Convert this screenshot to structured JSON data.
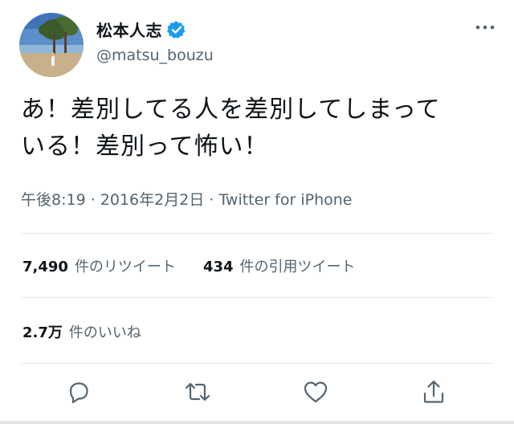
{
  "user": {
    "display_name": "松本人志",
    "handle": "@matsu_bouzu",
    "verified": true
  },
  "tweet": {
    "text_line1": "あ！差別してる人を差別してしまって",
    "text_line2": "いる！差別って怖い！"
  },
  "meta": {
    "time": "午後8:19",
    "separator": " · ",
    "date": "2016年2月2日",
    "source": "Twitter for iPhone"
  },
  "stats": {
    "retweets_count": "7,490",
    "retweets_label": "件のリツイート",
    "quotes_count": "434",
    "quotes_label": "件の引用ツイート",
    "likes_count": "2.7万",
    "likes_label": "件のいいね"
  },
  "colors": {
    "accent": "#1d9bf0",
    "text_primary": "#0f1419",
    "text_secondary": "#536471",
    "divider": "#e6e9ec"
  },
  "icons": {
    "more": "more-icon",
    "verified": "verified-badge-icon",
    "reply": "reply-icon",
    "retweet": "retweet-icon",
    "like": "like-icon",
    "share": "share-icon"
  }
}
